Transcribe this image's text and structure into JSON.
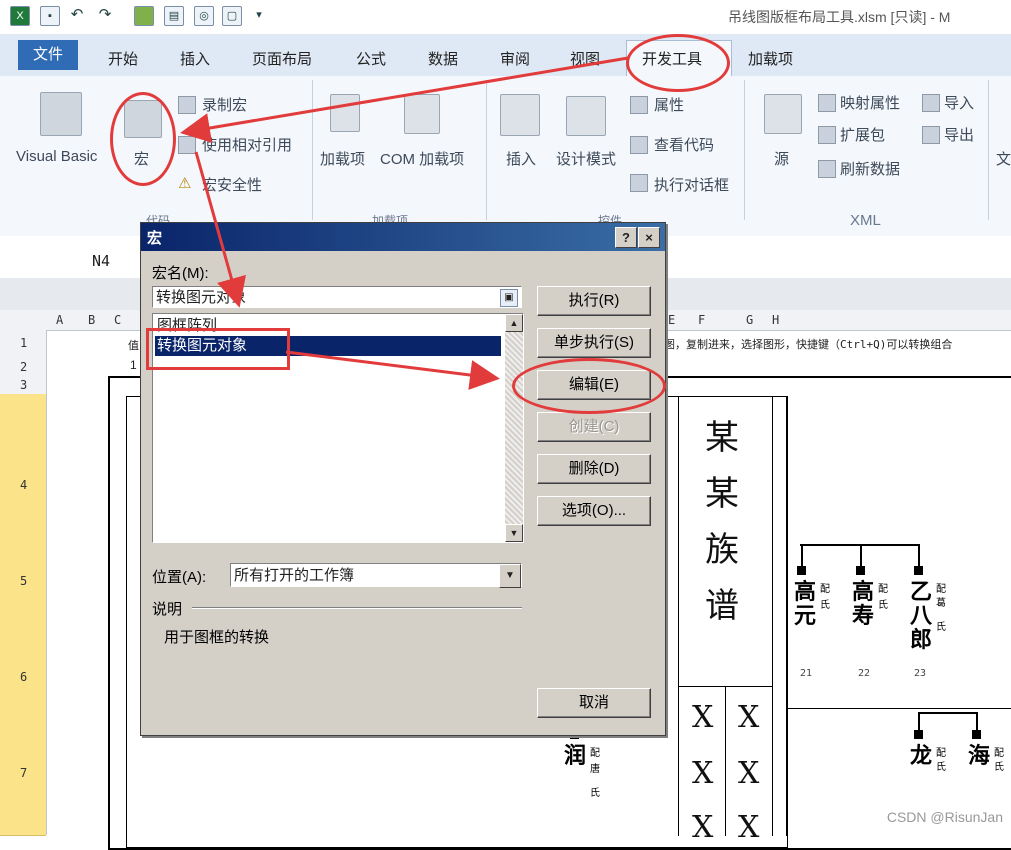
{
  "titlebar": {
    "title": "吊线图版框布局工具.xlsm  [只读] - M",
    "qa_icons": [
      "excel-icon",
      "save-icon",
      "undo-icon",
      "redo-icon",
      "macro-record-icon",
      "sheet-icon",
      "print-preview-icon",
      "doc-icon",
      "customize-icon"
    ]
  },
  "tabs": {
    "file": "文件",
    "items": [
      "开始",
      "插入",
      "页面布局",
      "公式",
      "数据",
      "审阅",
      "视图",
      "开发工具",
      "加载项"
    ]
  },
  "ribbon": {
    "visual_basic": "Visual Basic",
    "macro": "宏",
    "record_macro": "录制宏",
    "use_relative": "使用相对引用",
    "macro_security": "宏安全性",
    "group_code": "代码",
    "addins": "加载项",
    "com_addins": "COM 加载项",
    "group_addins": "加载项",
    "insert": "插入",
    "design_mode": "设计模式",
    "properties": "属性",
    "view_code": "查看代码",
    "run_dialog": "执行对话框",
    "group_controls": "控件",
    "source": "源",
    "map_props": "映射属性",
    "expansion": "扩展包",
    "refresh": "刷新数据",
    "import": "导入",
    "export": "导出",
    "group_xml": "XML",
    "doc": "文"
  },
  "sheet": {
    "cell_ref": "N4",
    "col_headers": [
      "A",
      "B",
      "C",
      "E",
      "F",
      "G",
      "H"
    ],
    "row_headers": [
      "1",
      "2",
      "3",
      "4",
      "5",
      "6",
      "7"
    ],
    "row1_text": "图，复制进来，选择图形，快捷键（Ctrl+Q)可以转换组合",
    "row1_left": "值",
    "row2_left": "1",
    "clan_title": [
      "某",
      "某",
      "族",
      "谱"
    ],
    "x_chars": [
      "X",
      "X",
      "X",
      "X",
      "X",
      "X"
    ],
    "people": [
      {
        "name": [
          "高",
          "元"
        ],
        "spouse": [
          "配",
          "氏"
        ],
        "num": "21"
      },
      {
        "name": [
          "高",
          "寿"
        ],
        "spouse": [
          "配",
          "氏"
        ],
        "num": "22"
      },
      {
        "name": [
          "乙",
          "八",
          "郎"
        ],
        "spouse": [
          "配",
          "葛",
          "氏"
        ],
        "num": "23"
      },
      {
        "name": [
          "龙"
        ],
        "spouse": [
          "配",
          "氏"
        ]
      },
      {
        "name": [
          "海"
        ],
        "spouse": [
          "配",
          "氏"
        ]
      },
      {
        "name": [
          "润"
        ],
        "spouse": [
          "配",
          "唐",
          "氏"
        ]
      }
    ]
  },
  "dialog": {
    "title": "宏",
    "help": "?",
    "close": "×",
    "name_label": "宏名(M):",
    "name_value": "转换图元对象",
    "list_items": [
      "图框阵列",
      "转换图元对象"
    ],
    "buttons": {
      "run": "执行(R)",
      "step": "单步执行(S)",
      "edit": "编辑(E)",
      "create": "创建(C)",
      "delete": "删除(D)",
      "options": "选项(O)...",
      "cancel": "取消"
    },
    "location_label": "位置(A):",
    "location_value": "所有打开的工作簿",
    "desc_label": "说明",
    "desc_text": "用于图框的转换"
  },
  "annotation_color": "#e23b3b",
  "watermark": "CSDN @RisunJan"
}
